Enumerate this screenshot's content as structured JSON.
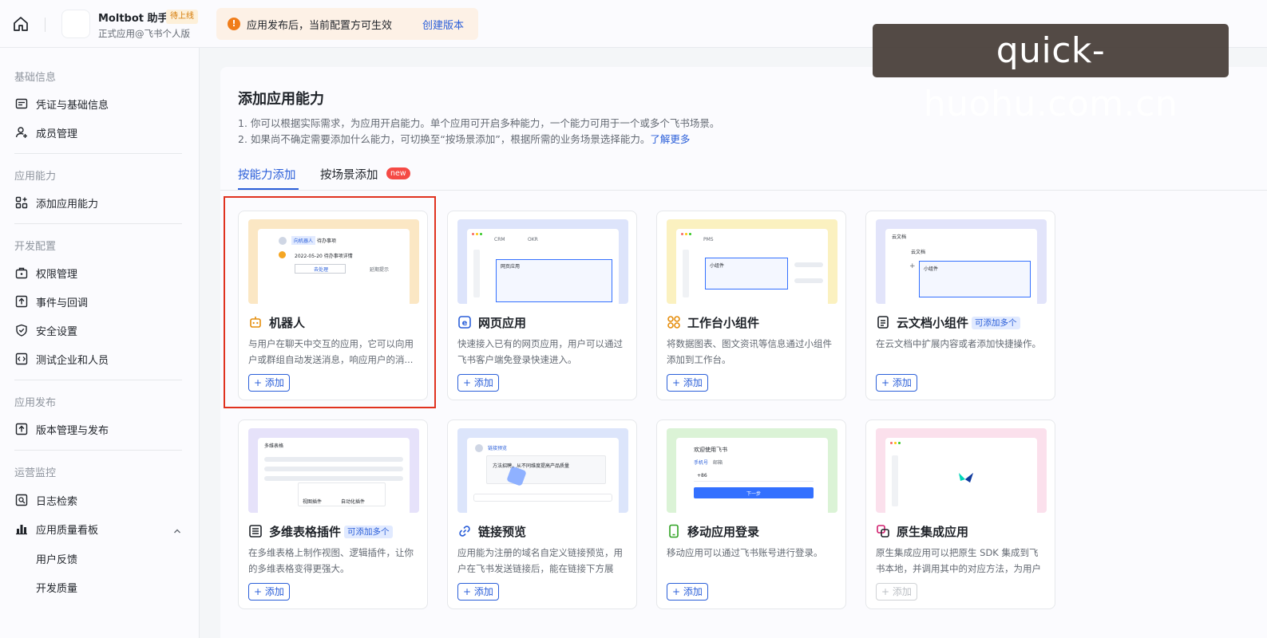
{
  "topbar": {
    "app_name": "Moltbot 助手",
    "app_tag": "待上线",
    "app_sub": "正式应用@飞书个人版",
    "notice_text": "应用发布后，当前配置方可生效",
    "notice_link": "创建版本"
  },
  "watermark": "quick-huohu.com.cn",
  "sidebar": {
    "sections": [
      "基础信息",
      "应用能力",
      "开发配置",
      "应用发布",
      "运营监控"
    ],
    "items": [
      {
        "label": "凭证与基础信息",
        "icon": "id-card-icon"
      },
      {
        "label": "成员管理",
        "icon": "add-user-icon"
      },
      {
        "label": "添加应用能力",
        "icon": "apps-add-icon"
      },
      {
        "label": "权限管理",
        "icon": "briefcase-lock-icon"
      },
      {
        "label": "事件与回调",
        "icon": "event-icon"
      },
      {
        "label": "安全设置",
        "icon": "shield-icon"
      },
      {
        "label": "测试企业和人员",
        "icon": "code-icon"
      },
      {
        "label": "版本管理与发布",
        "icon": "upload-icon"
      },
      {
        "label": "日志检索",
        "icon": "log-search-icon"
      },
      {
        "label": "应用质量看板",
        "icon": "bar-chart-icon"
      }
    ],
    "sub_items": [
      "用户反馈",
      "开发质量"
    ]
  },
  "main": {
    "title": "添加应用能力",
    "line1": "1. 你可以根据实际需求，为应用开启能力。单个应用可开启多种能力，一个能力可用于一个或多个飞书场景。",
    "line2": "2. 如果尚不确定需要添加什么能力，可切换至“按场景添加”，根据所需的业务场景选择能力。",
    "learn_more": "了解更多",
    "tabs": [
      {
        "label": "按能力添加",
        "active": true
      },
      {
        "label": "按场景添加",
        "badge": "new"
      }
    ],
    "cards": [
      {
        "title": "机器人",
        "desc": "与用户在聊天中交互的应用，它可以向用户或群组自动发送消息，响应用户的消...",
        "button": "+ 添加",
        "icon": "robot-icon",
        "preview_color": "#fbe7c4"
      },
      {
        "title": "网页应用",
        "desc": "快速接入已有的网页应用，用户可以通过飞书客户端免登录快速进入。",
        "button": "+ 添加",
        "icon": "web-app-icon",
        "preview_color": "#dde4fb"
      },
      {
        "title": "工作台小组件",
        "desc": "将数据图表、图文资讯等信息通过小组件添加到工作台。",
        "button": "+ 添加",
        "icon": "widget-icon",
        "preview_color": "#fbf1c0"
      },
      {
        "title": "云文档小组件",
        "badge": "可添加多个",
        "desc": "在云文档中扩展内容或者添加快捷操作。",
        "button": "+ 添加",
        "icon": "doc-icon",
        "preview_color": "#e2e4fa"
      },
      {
        "title": "多维表格插件",
        "badge": "可添加多个",
        "desc": "在多维表格上制作视图、逻辑插件，让你的多维表格变得更强大。",
        "button": "+ 添加",
        "icon": "table-plugin-icon",
        "preview_color": "#e6e2fa"
      },
      {
        "title": "链接预览",
        "desc": "应用能为注册的域名自定义链接预览，用户在飞书发送链接后，能在链接下方展示...",
        "button": "+ 添加",
        "icon": "link-icon",
        "preview_color": "#dce5fb"
      },
      {
        "title": "移动应用登录",
        "desc": "移动应用可以通过飞书账号进行登录。",
        "button": "+ 添加",
        "icon": "mobile-icon",
        "preview_color": "#dbf3d6"
      },
      {
        "title": "原生集成应用",
        "desc": "原生集成应用可以把原生 SDK 集成到飞书本地，并调用其中的对应方法，为用户提...",
        "button": "+ 添加",
        "button_disabled": true,
        "icon": "native-app-icon",
        "preview_color": "#fbe0ec"
      }
    ],
    "previews": {
      "robot": {
        "chip": "向机器人",
        "chip2": "待办事项",
        "date": "2022-05-20 待办事项详情",
        "btn1": "去处理",
        "btn2": "延期提示"
      },
      "web": {
        "tab1": "CRM",
        "tab2": "OKR",
        "box": "网页应用"
      },
      "widget": {
        "tab": "PMS",
        "box": "小组件"
      },
      "doc": {
        "crumb": "云文档",
        "title": "云文档",
        "box": "小组件"
      },
      "base": {
        "crumb": "多维表格",
        "a": "视图插件",
        "b": "自动化插件"
      },
      "link": {
        "top": "链接预览",
        "mid": "方法招聘，从不同维度提高产品质量"
      },
      "mobile": {
        "title": "欢迎使用飞书",
        "tab1": "手机号",
        "tab2": "邮箱",
        "code": "+86",
        "btn": "下一步"
      }
    }
  }
}
